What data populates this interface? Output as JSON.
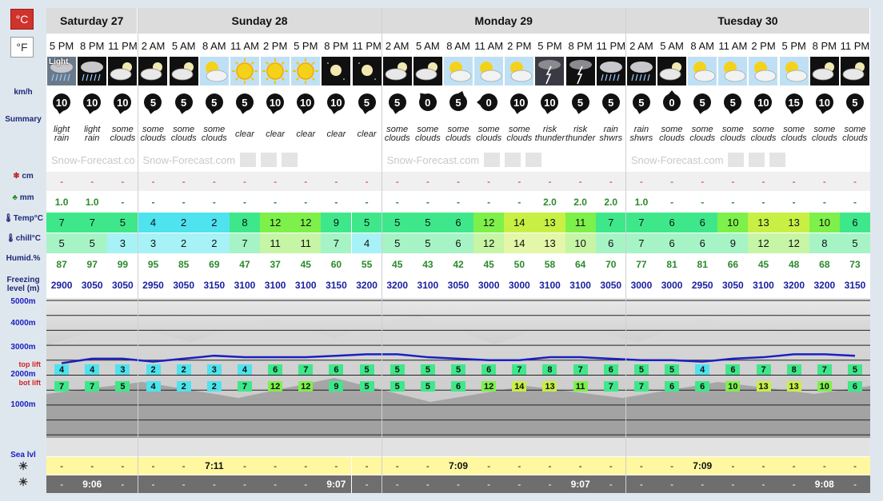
{
  "units": {
    "celsius": "°C",
    "fahrenheit": "°F"
  },
  "labels": {
    "wind": "km/h",
    "summary": "Summary",
    "snow": "cm",
    "rain": "mm",
    "temp": "Temp°C",
    "chill": "chill°C",
    "humid": "Humid.%",
    "freezing": "Freezing level (m)",
    "alt_5000": "5000m",
    "alt_4000": "4000m",
    "alt_3000": "3000m",
    "alt_2000": "2000m",
    "alt_1000": "1000m",
    "top_lift": "top lift",
    "bot_lift": "bot lift",
    "sea": "Sea lvl"
  },
  "watermark": "Snow-Forecast.com",
  "days": [
    {
      "name": "Saturday 27",
      "cols": 3
    },
    {
      "name": "Sunday 28",
      "cols": 8
    },
    {
      "name": "Monday 29",
      "cols": 8
    },
    {
      "name": "Tuesday 30",
      "cols": 8
    }
  ],
  "columns": [
    {
      "time": "5 PM",
      "wx": "rain",
      "wx_label": "Light",
      "wind": "10",
      "wdir": 190,
      "summary": "light rain",
      "snow": "-",
      "rain": "1.0",
      "temp": "7",
      "chill": "5",
      "humid": "87",
      "freeze": "2900",
      "top": "4",
      "bot": "7",
      "rise": "-",
      "set": "-"
    },
    {
      "time": "8 PM",
      "wx": "rain-night",
      "wx_label": "",
      "wind": "10",
      "wdir": 190,
      "summary": "light rain",
      "snow": "-",
      "rain": "1.0",
      "temp": "7",
      "chill": "5",
      "humid": "97",
      "freeze": "3050",
      "top": "4",
      "bot": "7",
      "rise": "-",
      "set": "9:06"
    },
    {
      "time": "11 PM",
      "wx": "cloud-night",
      "wx_label": "",
      "wind": "10",
      "wdir": 190,
      "summary": "some clouds",
      "snow": "-",
      "rain": "-",
      "temp": "5",
      "chill": "3",
      "humid": "99",
      "freeze": "3050",
      "top": "3",
      "bot": "5",
      "rise": "-",
      "set": "-"
    },
    {
      "time": "2 AM",
      "wx": "cloud-night",
      "wx_label": "",
      "wind": "5",
      "wdir": 190,
      "summary": "some clouds",
      "snow": "-",
      "rain": "-",
      "temp": "4",
      "chill": "3",
      "humid": "95",
      "freeze": "2950",
      "top": "2",
      "bot": "4",
      "rise": "-",
      "set": "-"
    },
    {
      "time": "5 AM",
      "wx": "cloud-night",
      "wx_label": "",
      "wind": "5",
      "wdir": 190,
      "summary": "some clouds",
      "snow": "-",
      "rain": "-",
      "temp": "2",
      "chill": "2",
      "humid": "85",
      "freeze": "3050",
      "top": "2",
      "bot": "2",
      "rise": "-",
      "set": "-"
    },
    {
      "time": "8 AM",
      "wx": "sun-cloud",
      "wx_label": "",
      "wind": "5",
      "wdir": 190,
      "summary": "some clouds",
      "snow": "-",
      "rain": "-",
      "temp": "2",
      "chill": "2",
      "humid": "69",
      "freeze": "3150",
      "top": "3",
      "bot": "2",
      "rise": "7:11",
      "set": "-"
    },
    {
      "time": "11 AM",
      "wx": "sun",
      "wx_label": "",
      "wind": "5",
      "wdir": 190,
      "summary": "clear",
      "snow": "-",
      "rain": "-",
      "temp": "8",
      "chill": "7",
      "humid": "47",
      "freeze": "3100",
      "top": "4",
      "bot": "7",
      "rise": "-",
      "set": "-"
    },
    {
      "time": "2 PM",
      "wx": "sun",
      "wx_label": "",
      "wind": "10",
      "wdir": 190,
      "summary": "clear",
      "snow": "-",
      "rain": "-",
      "temp": "12",
      "chill": "11",
      "humid": "37",
      "freeze": "3100",
      "top": "6",
      "bot": "12",
      "rise": "-",
      "set": "-"
    },
    {
      "time": "5 PM",
      "wx": "sun",
      "wx_label": "",
      "wind": "10",
      "wdir": 190,
      "summary": "clear",
      "snow": "-",
      "rain": "-",
      "temp": "12",
      "chill": "11",
      "humid": "45",
      "freeze": "3100",
      "top": "7",
      "bot": "12",
      "rise": "-",
      "set": "-"
    },
    {
      "time": "8 PM",
      "wx": "moon",
      "wx_label": "",
      "wind": "10",
      "wdir": 190,
      "summary": "clear",
      "snow": "-",
      "rain": "-",
      "temp": "9",
      "chill": "7",
      "humid": "60",
      "freeze": "3150",
      "top": "6",
      "bot": "9",
      "rise": "-",
      "set": "9:07"
    },
    {
      "time": "11 PM",
      "wx": "moon",
      "wx_label": "",
      "wind": "5",
      "wdir": 190,
      "summary": "clear",
      "snow": "-",
      "rain": "-",
      "temp": "5",
      "chill": "4",
      "humid": "55",
      "freeze": "3200",
      "top": "5",
      "bot": "5",
      "rise": "-",
      "set": "-"
    },
    {
      "time": "2 AM",
      "wx": "cloud-night",
      "wx_label": "",
      "wind": "5",
      "wdir": 190,
      "summary": "some clouds",
      "snow": "-",
      "rain": "-",
      "temp": "5",
      "chill": "5",
      "humid": "45",
      "freeze": "3200",
      "top": "5",
      "bot": "5",
      "rise": "-",
      "set": "-"
    },
    {
      "time": "5 AM",
      "wx": "cloud-night",
      "wx_label": "",
      "wind": "0",
      "wdir": 320,
      "summary": "some clouds",
      "snow": "-",
      "rain": "-",
      "temp": "5",
      "chill": "5",
      "humid": "43",
      "freeze": "3100",
      "top": "5",
      "bot": "5",
      "rise": "-",
      "set": "-"
    },
    {
      "time": "8 AM",
      "wx": "sun-cloud",
      "wx_label": "",
      "wind": "5",
      "wdir": 20,
      "summary": "some clouds",
      "snow": "-",
      "rain": "-",
      "temp": "6",
      "chill": "6",
      "humid": "42",
      "freeze": "3050",
      "top": "5",
      "bot": "6",
      "rise": "7:09",
      "set": "-"
    },
    {
      "time": "11 AM",
      "wx": "sun-cloud",
      "wx_label": "",
      "wind": "0",
      "wdir": 270,
      "summary": "some clouds",
      "snow": "-",
      "rain": "-",
      "temp": "12",
      "chill": "12",
      "humid": "45",
      "freeze": "3000",
      "top": "6",
      "bot": "12",
      "rise": "-",
      "set": "-"
    },
    {
      "time": "2 PM",
      "wx": "sun-cloud",
      "wx_label": "",
      "wind": "10",
      "wdir": 190,
      "summary": "some clouds",
      "snow": "-",
      "rain": "-",
      "temp": "14",
      "chill": "14",
      "humid": "50",
      "freeze": "3000",
      "top": "7",
      "bot": "14",
      "rise": "-",
      "set": "-"
    },
    {
      "time": "5 PM",
      "wx": "thunder",
      "wx_label": "",
      "wind": "10",
      "wdir": 190,
      "summary": "risk thunder",
      "snow": "-",
      "rain": "2.0",
      "temp": "13",
      "chill": "13",
      "humid": "58",
      "freeze": "3100",
      "top": "8",
      "bot": "13",
      "rise": "-",
      "set": "-"
    },
    {
      "time": "8 PM",
      "wx": "thunder-night",
      "wx_label": "",
      "wind": "5",
      "wdir": 190,
      "summary": "risk thunder",
      "snow": "-",
      "rain": "2.0",
      "temp": "11",
      "chill": "10",
      "humid": "64",
      "freeze": "3100",
      "top": "7",
      "bot": "11",
      "rise": "-",
      "set": "9:07"
    },
    {
      "time": "11 PM",
      "wx": "rain-night",
      "wx_label": "",
      "wind": "5",
      "wdir": 190,
      "summary": "rain shwrs",
      "snow": "-",
      "rain": "2.0",
      "temp": "7",
      "chill": "6",
      "humid": "70",
      "freeze": "3050",
      "top": "6",
      "bot": "7",
      "rise": "-",
      "set": "-"
    },
    {
      "time": "2 AM",
      "wx": "rain-night",
      "wx_label": "",
      "wind": "5",
      "wdir": 190,
      "summary": "rain shwrs",
      "snow": "-",
      "rain": "1.0",
      "temp": "7",
      "chill": "7",
      "humid": "77",
      "freeze": "3000",
      "top": "5",
      "bot": "7",
      "rise": "-",
      "set": "-"
    },
    {
      "time": "5 AM",
      "wx": "cloud-night",
      "wx_label": "",
      "wind": "0",
      "wdir": 0,
      "summary": "some clouds",
      "snow": "-",
      "rain": "-",
      "temp": "6",
      "chill": "6",
      "humid": "81",
      "freeze": "3000",
      "top": "5",
      "bot": "6",
      "rise": "-",
      "set": "-"
    },
    {
      "time": "8 AM",
      "wx": "sun-cloud",
      "wx_label": "",
      "wind": "5",
      "wdir": 190,
      "summary": "some clouds",
      "snow": "-",
      "rain": "-",
      "temp": "6",
      "chill": "6",
      "humid": "81",
      "freeze": "2950",
      "top": "4",
      "bot": "6",
      "rise": "7:09",
      "set": "-"
    },
    {
      "time": "11 AM",
      "wx": "sun-cloud",
      "wx_label": "",
      "wind": "5",
      "wdir": 190,
      "summary": "some clouds",
      "snow": "-",
      "rain": "-",
      "temp": "10",
      "chill": "9",
      "humid": "66",
      "freeze": "3050",
      "top": "6",
      "bot": "10",
      "rise": "-",
      "set": "-"
    },
    {
      "time": "2 PM",
      "wx": "sun-cloud",
      "wx_label": "",
      "wind": "10",
      "wdir": 190,
      "summary": "some clouds",
      "snow": "-",
      "rain": "-",
      "temp": "13",
      "chill": "12",
      "humid": "45",
      "freeze": "3100",
      "top": "7",
      "bot": "13",
      "rise": "-",
      "set": "-"
    },
    {
      "time": "5 PM",
      "wx": "sun-cloud",
      "wx_label": "",
      "wind": "15",
      "wdir": 190,
      "summary": "some clouds",
      "snow": "-",
      "rain": "-",
      "temp": "13",
      "chill": "12",
      "humid": "48",
      "freeze": "3200",
      "top": "8",
      "bot": "13",
      "rise": "-",
      "set": "-"
    },
    {
      "time": "8 PM",
      "wx": "cloud-night",
      "wx_label": "",
      "wind": "10",
      "wdir": 190,
      "summary": "some clouds",
      "snow": "-",
      "rain": "-",
      "temp": "10",
      "chill": "8",
      "humid": "68",
      "freeze": "3200",
      "top": "7",
      "bot": "10",
      "rise": "-",
      "set": "9:08"
    },
    {
      "time": "11 PM",
      "wx": "cloud-night",
      "wx_label": "",
      "wind": "5",
      "wdir": 190,
      "summary": "some clouds",
      "snow": "-",
      "rain": "-",
      "temp": "6",
      "chill": "5",
      "humid": "73",
      "freeze": "3150",
      "top": "5",
      "bot": "6",
      "rise": "-",
      "set": "-"
    }
  ],
  "colors": {
    "temp_cold": "#4ee3ee",
    "temp_cool": "#3ee88a",
    "temp_mild": "#7ef04a",
    "temp_warm": "#c8f044",
    "chill_cold": "#a6f2f6",
    "chill_cool": "#a6f4c6",
    "chill_mild": "#c6f5a6",
    "chill_warm": "#e4f6a8",
    "freeze_line": "#1a20c0",
    "sun_row": "#fff8a0",
    "set_row": "#6e6e6e"
  }
}
